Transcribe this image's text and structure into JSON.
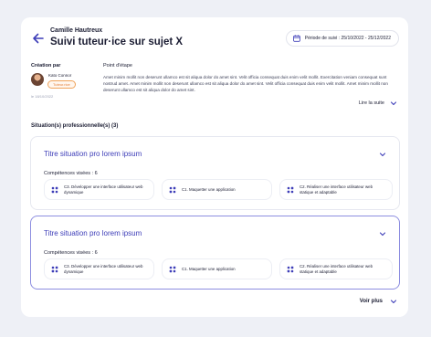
{
  "header": {
    "user_name": "Camille Hautreux",
    "title": "Suivi tuteur·ice sur sujet X",
    "period": "Période de suivi : 25/10/2022 - 25/12/2022"
  },
  "creation": {
    "label": "Création par",
    "author": "Kato Connor",
    "role": "Tuteur.rice",
    "date": "le 18/10/2022"
  },
  "point": {
    "label": "Point d'étape",
    "text": "Amet minim mollit non deserunt ullamco est sit aliqua dolor do amet sint. Velit officia consequat duis enim velit mollit. Exercitation veniam consequat sunt nostrud amet. Amet minim mollit non deserunt ullamco est sit aliqua dolor do amet sint. Velit officia consequat duis enim velit mollit. Amet minim mollit non deserunt ullamco est sit aliqua dolor do amet sint.",
    "read_more": "Lire la suite"
  },
  "situations": {
    "label": "Situation(s) professionnelle(s) (3)",
    "items": [
      {
        "title": "Titre situation pro lorem ipsum",
        "skills_label": "Compétences visées : 6",
        "skills": [
          "C3. Développer une interface utilisateur web dynamique",
          "C1. Maquetter une application",
          "C2. Réaliser une interface utilisateur web statique et adaptable"
        ]
      },
      {
        "title": "Titre situation pro lorem ipsum",
        "skills_label": "Compétences visées : 6",
        "skills": [
          "C3. Développer une interface utilisateur web dynamique",
          "C1. Maquetter une application",
          "C2. Réaliser une interface utilisateur web statique et adaptable"
        ]
      }
    ]
  },
  "see_more": "Voir plus",
  "colors": {
    "accent": "#3d3db8",
    "badge": "#e2803b",
    "background": "#eef0f6"
  },
  "icons": {
    "back": "arrow-left-icon",
    "calendar": "calendar-icon",
    "chevron": "chevron-down-icon",
    "skill": "apps-grid-icon"
  }
}
